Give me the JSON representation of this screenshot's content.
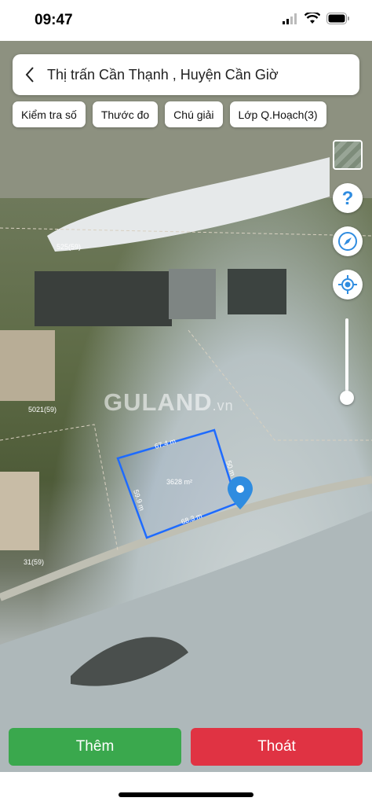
{
  "status": {
    "time": "09:47"
  },
  "header": {
    "title": "Thị trấn Cần Thạnh , Huyện Cần Giờ"
  },
  "chips": [
    {
      "label": "Kiểm tra số"
    },
    {
      "label": "Thước đo"
    },
    {
      "label": "Chú giải"
    },
    {
      "label": "Lớp Q.Hoạch(3)"
    }
  ],
  "map": {
    "watermark_main": "GULAND",
    "watermark_suffix": ".vn",
    "parcel": {
      "area": "3628 m²",
      "side_top": "67.4 m",
      "side_left": "59.9 m",
      "side_right": "50 m",
      "side_bottom": "68.3 m",
      "outline_color": "#1e6bff"
    },
    "labels": [
      "525(59)",
      "5021(59)",
      "31(59)"
    ]
  },
  "icons": {
    "help": "question-icon",
    "compass": "compass-icon",
    "locate": "locate-icon",
    "pin": "map-pin-icon"
  },
  "actions": {
    "add": "Thêm",
    "exit": "Thoát"
  },
  "colors": {
    "add": "#3aa84d",
    "exit": "#e03343",
    "accent": "#2f8ce0"
  }
}
